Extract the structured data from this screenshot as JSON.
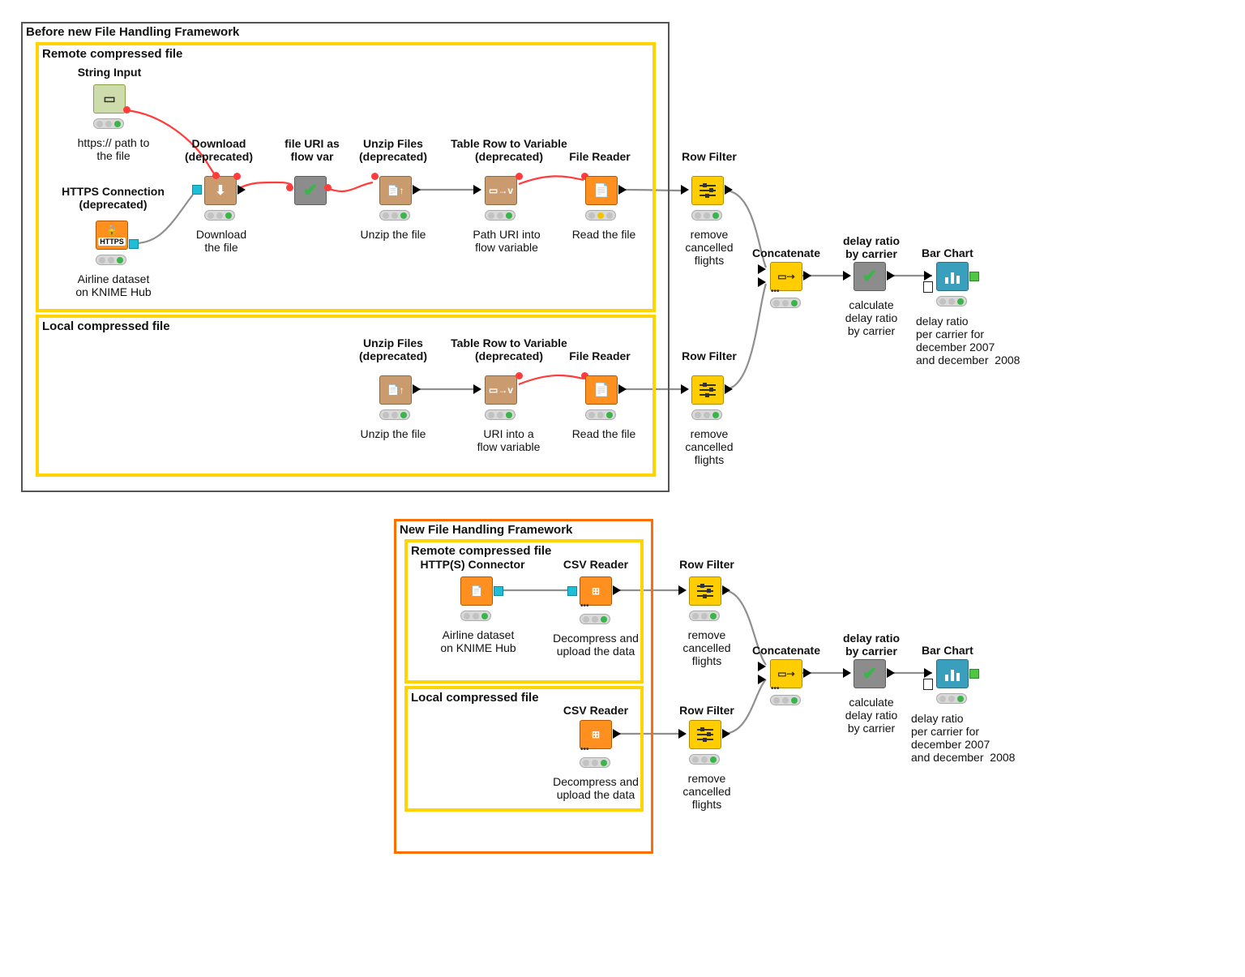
{
  "frames": {
    "before": {
      "title": "Before new File Handling Framework"
    },
    "before_remote": {
      "title": "Remote compressed file"
    },
    "before_local": {
      "title": "Local compressed file"
    },
    "after": {
      "title": "New File Handling Framework"
    },
    "after_remote": {
      "title": "Remote compressed file"
    },
    "after_local": {
      "title": "Local compressed file"
    }
  },
  "nodes": {
    "before": {
      "string_input": {
        "title": "String Input",
        "desc": "https:// path to\nthe file"
      },
      "https_conn": {
        "title": "HTTPS Connection\n(deprecated)",
        "desc": "Airline dataset\non KNIME Hub"
      },
      "download": {
        "title": "Download\n(deprecated)",
        "desc": "Download\nthe file"
      },
      "file_uri": {
        "title": "file URI as\nflow var",
        "desc": ""
      },
      "unzip1": {
        "title": "Unzip Files\n(deprecated)",
        "desc": "Unzip the file"
      },
      "trv1": {
        "title": "Table Row to Variable\n(deprecated)",
        "desc": "Path URI into\nflow variable"
      },
      "file_reader1": {
        "title": "File Reader",
        "desc": "Read the file"
      },
      "row_filter1": {
        "title": "Row Filter",
        "desc": "remove\ncancelled\nflights"
      },
      "unzip2": {
        "title": "Unzip Files\n(deprecated)",
        "desc": "Unzip the file"
      },
      "trv2": {
        "title": "Table Row to Variable\n(deprecated)",
        "desc": "URI into a\nflow variable"
      },
      "file_reader2": {
        "title": "File Reader",
        "desc": "Read the file"
      },
      "row_filter2": {
        "title": "Row Filter",
        "desc": "remove\ncancelled\nflights"
      },
      "concat": {
        "title": "Concatenate",
        "desc": ""
      },
      "delay_ratio": {
        "title": "delay ratio\nby carrier",
        "desc": "calculate\ndelay ratio\nby carrier"
      },
      "bar_chart": {
        "title": "Bar Chart",
        "desc": "delay ratio\nper carrier for\ndecember 2007\nand december  2008"
      }
    },
    "after": {
      "https_conn": {
        "title": "HTTP(S) Connector",
        "desc": "Airline dataset\non KNIME Hub"
      },
      "csv_reader1": {
        "title": "CSV Reader",
        "desc": "Decompress and\nupload the data"
      },
      "row_filter1": {
        "title": "Row Filter",
        "desc": "remove\ncancelled\nflights"
      },
      "csv_reader2": {
        "title": "CSV Reader",
        "desc": "Decompress and\nupload the data"
      },
      "row_filter2": {
        "title": "Row Filter",
        "desc": "remove\ncancelled\nflights"
      },
      "concat": {
        "title": "Concatenate",
        "desc": ""
      },
      "delay_ratio": {
        "title": "delay ratio\nby carrier",
        "desc": "calculate\ndelay ratio\nby carrier"
      },
      "bar_chart": {
        "title": "Bar Chart",
        "desc": "delay ratio\nper carrier for\ndecember 2007\nand december  2008"
      }
    }
  },
  "colors": {
    "node_orange": "#ff8f1e",
    "node_tan": "#c99b6e",
    "node_yellow": "#ffcd00",
    "node_gray": "#8c8c8c",
    "node_blue": "#3a9fbd",
    "border_gray": "#555555",
    "border_orange": "#ff6e00",
    "annotation_yellow": "#ffd400",
    "wire_gray": "#8f8f8f",
    "wire_red": "#ff3b3b"
  }
}
